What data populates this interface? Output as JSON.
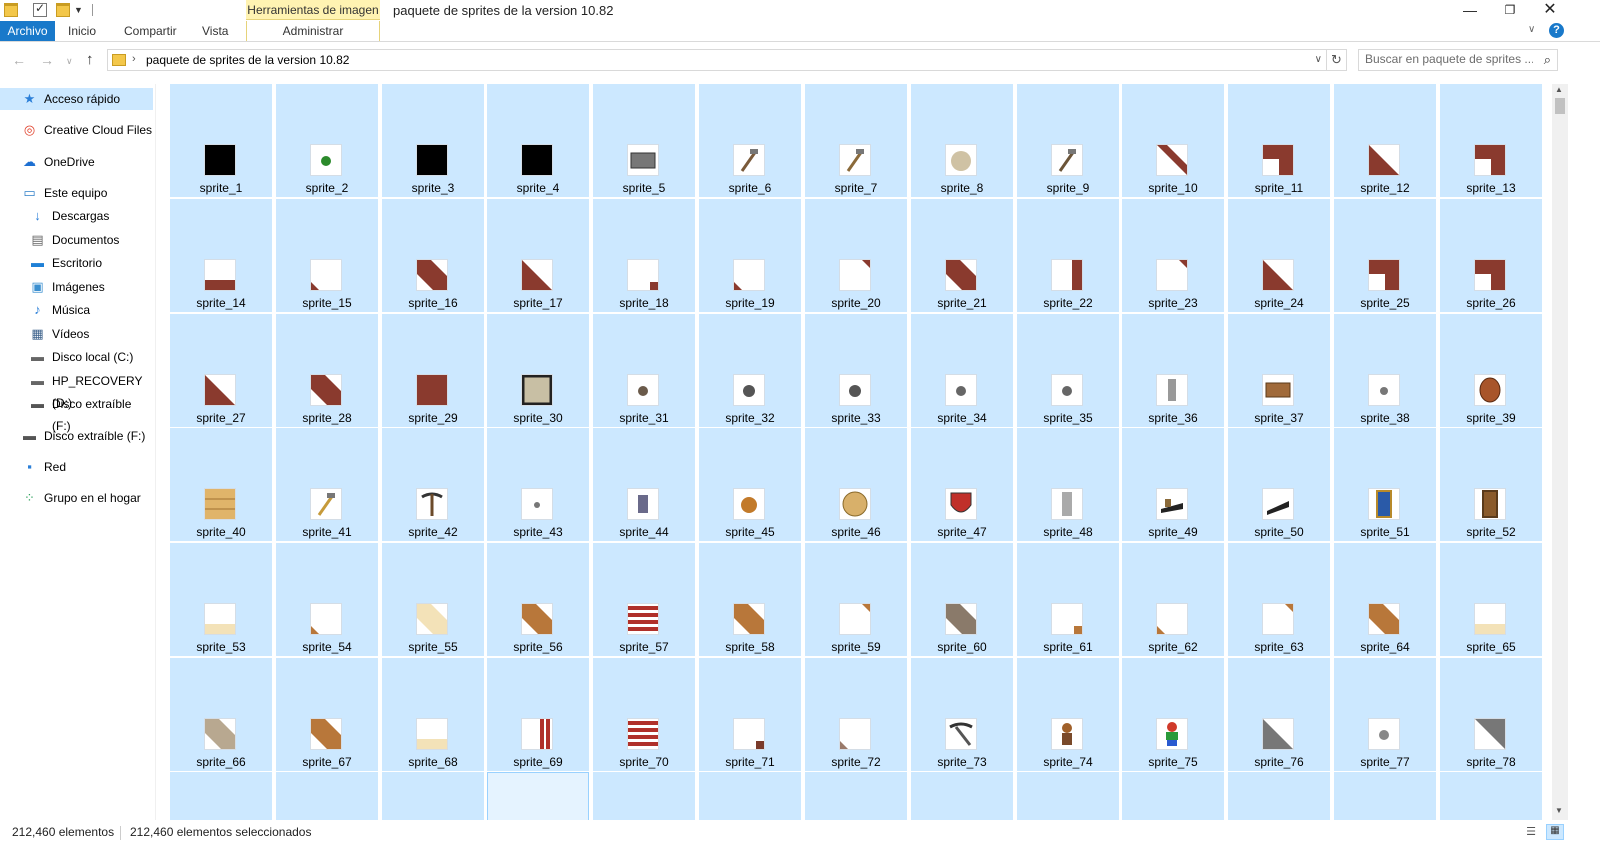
{
  "window": {
    "title": "paquete de sprites de la version 10.82",
    "contextual_tab_title": "Herramientas de imagen",
    "minimize_glyph": "—",
    "maximize_glyph": "❐",
    "close_glyph": "✕"
  },
  "ribbon": {
    "tabs": [
      "Archivo",
      "Inicio",
      "Compartir",
      "Vista",
      "Administrar"
    ],
    "active_tab": "Archivo",
    "help_glyph": "?"
  },
  "address": {
    "path": "paquete de sprites de la version 10.82",
    "separator": "›",
    "search_placeholder": "Buscar en paquete de sprites ..."
  },
  "sidebar": {
    "items": [
      {
        "label": "Acceso rápido",
        "icon": "star-icon",
        "selected": true
      },
      {
        "label": "Creative Cloud Files",
        "icon": "creative-cloud-icon"
      },
      {
        "label": "OneDrive",
        "icon": "cloud-icon"
      },
      {
        "label": "Este equipo",
        "icon": "computer-icon"
      },
      {
        "label": "Descargas",
        "icon": "download-icon"
      },
      {
        "label": "Documentos",
        "icon": "document-icon"
      },
      {
        "label": "Escritorio",
        "icon": "desktop-icon"
      },
      {
        "label": "Imágenes",
        "icon": "image-icon"
      },
      {
        "label": "Música",
        "icon": "music-icon"
      },
      {
        "label": "Vídeos",
        "icon": "video-icon"
      },
      {
        "label": "Disco local (C:)",
        "icon": "drive-icon"
      },
      {
        "label": "HP_RECOVERY (D:)",
        "icon": "drive-icon"
      },
      {
        "label": "Disco extraíble (F:)",
        "icon": "removable-drive-icon"
      },
      {
        "label": "Disco extraíble (F:)",
        "icon": "removable-drive-icon"
      },
      {
        "label": "Red",
        "icon": "network-icon"
      },
      {
        "label": "Grupo en el hogar",
        "icon": "homegroup-icon"
      }
    ]
  },
  "files": [
    "sprite_1",
    "sprite_2",
    "sprite_3",
    "sprite_4",
    "sprite_5",
    "sprite_6",
    "sprite_7",
    "sprite_8",
    "sprite_9",
    "sprite_10",
    "sprite_11",
    "sprite_12",
    "sprite_13",
    "sprite_14",
    "sprite_15",
    "sprite_16",
    "sprite_17",
    "sprite_18",
    "sprite_19",
    "sprite_20",
    "sprite_21",
    "sprite_22",
    "sprite_23",
    "sprite_24",
    "sprite_25",
    "sprite_26",
    "sprite_27",
    "sprite_28",
    "sprite_29",
    "sprite_30",
    "sprite_31",
    "sprite_32",
    "sprite_33",
    "sprite_34",
    "sprite_35",
    "sprite_36",
    "sprite_37",
    "sprite_38",
    "sprite_39",
    "sprite_40",
    "sprite_41",
    "sprite_42",
    "sprite_43",
    "sprite_44",
    "sprite_45",
    "sprite_46",
    "sprite_47",
    "sprite_48",
    "sprite_49",
    "sprite_50",
    "sprite_51",
    "sprite_52",
    "sprite_53",
    "sprite_54",
    "sprite_55",
    "sprite_56",
    "sprite_57",
    "sprite_58",
    "sprite_59",
    "sprite_60",
    "sprite_61",
    "sprite_62",
    "sprite_63",
    "sprite_64",
    "sprite_65",
    "sprite_66",
    "sprite_67",
    "sprite_68",
    "sprite_69",
    "sprite_70",
    "sprite_71",
    "sprite_72",
    "sprite_73",
    "sprite_74",
    "sprite_75",
    "sprite_76",
    "sprite_77",
    "sprite_78",
    "",
    "",
    "",
    "",
    "",
    "",
    "",
    "",
    "",
    "",
    "",
    "",
    ""
  ],
  "focused_file_index": 81,
  "status": {
    "count": "212,460 elementos",
    "selected": "212,460 elementos seleccionados"
  },
  "colors": {
    "accent": "#1979ca",
    "selection": "#cce8ff",
    "contextual_tab": "#fff3b2",
    "brick": "#8a3a2e",
    "wood": "#b8773a"
  }
}
